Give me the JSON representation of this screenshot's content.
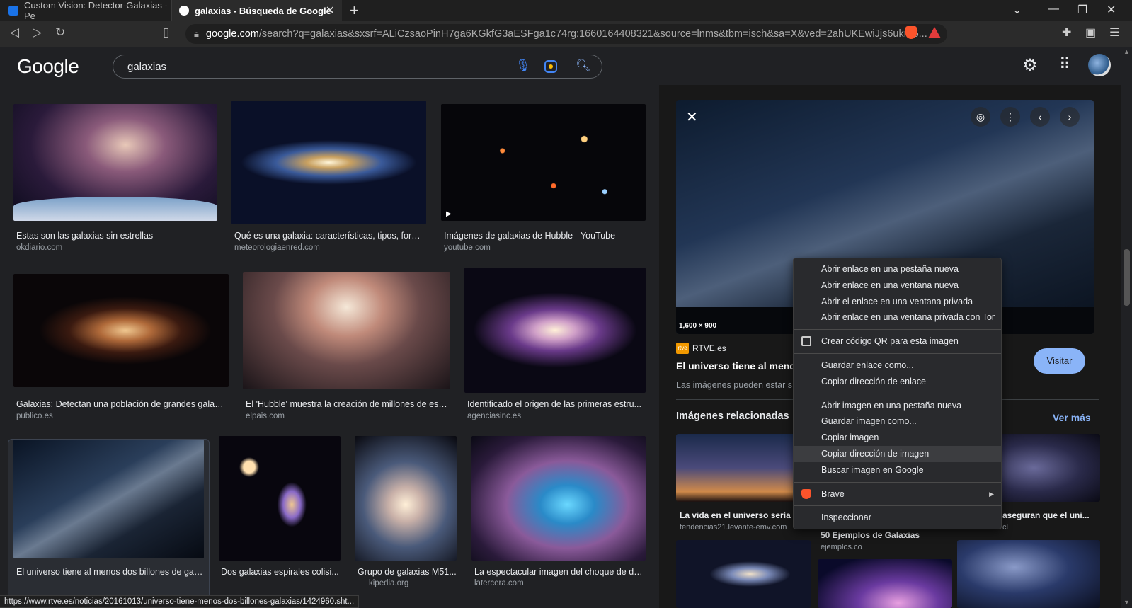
{
  "tabs": [
    {
      "title": "Custom Vision: Detector-Galaxias - Pe"
    },
    {
      "title": "galaxias - Búsqueda de Google"
    }
  ],
  "url": {
    "domain": "google.com",
    "rest": "/search?q=galaxias&sxsrf=ALiCzsaoPinH7ga6KGkfG3aESFga1c74rg:1660164408321&source=lnms&tbm=isch&sa=X&ved=2ahUKEwiJjs6ukr35..."
  },
  "google": {
    "logo": "Google",
    "query": "galaxias"
  },
  "results": [
    {
      "caption": "Estas son las galaxias sin estrellas",
      "source": "okdiario.com"
    },
    {
      "caption": "Qué es una galaxia: características, tipos, form...",
      "source": "meteorologiaenred.com"
    },
    {
      "caption": "Imágenes de galaxias de Hubble - YouTube",
      "source": "youtube.com"
    },
    {
      "caption": "Galaxias: Detectan una población de grandes galaxi...",
      "source": "publico.es"
    },
    {
      "caption": "El 'Hubble' muestra la creación de millones de estr...",
      "source": "elpais.com"
    },
    {
      "caption": "Identificado el origen de las primeras estru...",
      "source": "agenciasinc.es"
    },
    {
      "caption": "El universo tiene al menos dos billones de gal...",
      "source": ""
    },
    {
      "caption": "Dos galaxias espirales colisi...",
      "source": ""
    },
    {
      "caption": "Grupo de galaxias M51...",
      "source": "kipedia.org"
    },
    {
      "caption": "La espectacular imagen del choque de do...",
      "source": "latercera.com"
    }
  ],
  "panel": {
    "dimensions": "1,600 × 900",
    "site_icon": "rtve",
    "site": "RTVE.es",
    "title": "El universo tiene al menc",
    "disclaimer": "Las imágenes pueden estar s",
    "visit": "Visitar",
    "related_heading": "Imágenes relacionadas",
    "see_more": "Ver más",
    "related": [
      {
        "caption": "La vida en el universo sería m",
        "source": "tendencias21.levante-emv.com"
      },
      {
        "caption": "50 Ejemplos de Galaxias",
        "source": "ejemplos.co"
      },
      {
        "caption": "aseguran que el uni...",
        "source": "cl"
      }
    ]
  },
  "context_menu": {
    "group1": [
      "Abrir enlace en una pestaña nueva",
      "Abrir enlace en una ventana nueva",
      "Abrir el enlace en una ventana privada",
      "Abrir enlace en una ventana privada con Tor"
    ],
    "qr": "Crear código QR para esta imagen",
    "group2": [
      "Guardar enlace como...",
      "Copiar dirección de enlace"
    ],
    "group3": [
      "Abrir imagen en una pestaña nueva",
      "Guardar imagen como...",
      "Copiar imagen",
      "Copiar dirección de imagen",
      "Buscar imagen en Google"
    ],
    "brave": "Brave",
    "inspect": "Inspeccionar"
  },
  "status_url": "https://www.rtve.es/noticias/20161013/universo-tiene-menos-dos-billones-galaxias/1424960.sht..."
}
